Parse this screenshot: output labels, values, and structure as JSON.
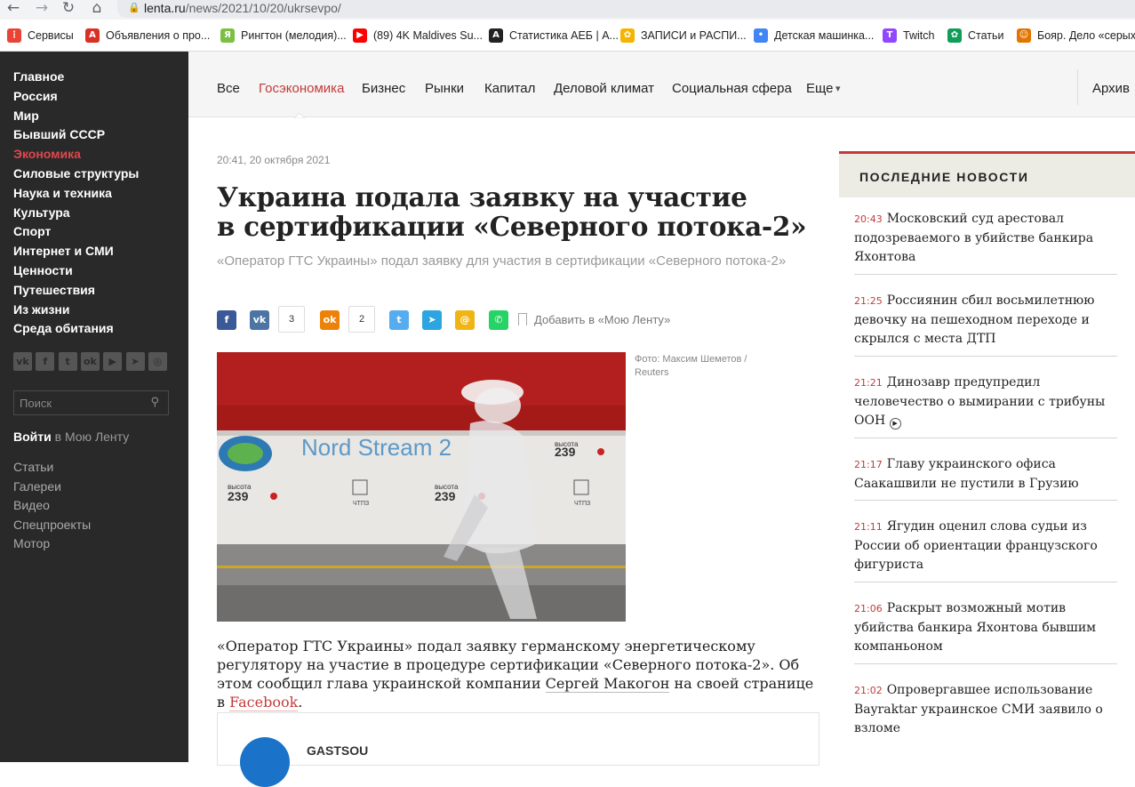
{
  "browser": {
    "url_host": "lenta.ru",
    "url_path": "/news/2021/10/20/ukrsevpo/",
    "bookmarks": [
      {
        "label": "Сервисы",
        "icon": "apps-grid-icon",
        "color": "#e94335"
      },
      {
        "label": "Объявления о про...",
        "icon": "avito-icon",
        "color": "#d93025"
      },
      {
        "label": "Рингтон (мелодия)...",
        "icon": "yandex-icon",
        "color": "#7bc043"
      },
      {
        "label": "(89) 4K Maldives Su...",
        "icon": "youtube-icon",
        "color": "#ff0000"
      },
      {
        "label": "Статистика АЕБ | А...",
        "icon": "aeb-icon",
        "color": "#222222"
      },
      {
        "label": "ЗАПИСИ и РАСПИ...",
        "icon": "colorful-wheel-icon",
        "color": "#f4b400"
      },
      {
        "label": "Детская машинка...",
        "icon": "dots-icon",
        "color": "#4285f4"
      },
      {
        "label": "Twitch",
        "icon": "twitch-icon",
        "color": "#9146ff"
      },
      {
        "label": "Статьи",
        "icon": "colorful-wheel-icon",
        "color": "#0f9d58"
      },
      {
        "label": "Бояр. Дело «серых",
        "icon": "face-icon",
        "color": "#e37400"
      }
    ]
  },
  "sidebar": {
    "links": [
      "Главное",
      "Россия",
      "Мир",
      "Бывший СССР",
      "Экономика",
      "Силовые структуры",
      "Наука и техника",
      "Культура",
      "Спорт",
      "Интернет и СМИ",
      "Ценности",
      "Путешествия",
      "Из жизни",
      "Среда обитания"
    ],
    "active_index": 4,
    "socials": [
      "vk-icon",
      "facebook-icon",
      "twitter-icon",
      "odnoklassniki-icon",
      "youtube-icon",
      "telegram-icon",
      "instagram-icon"
    ],
    "search_placeholder": "Поиск",
    "login_bold": "Войти",
    "login_rest": " в Мою Ленту",
    "sections": [
      "Статьи",
      "Галереи",
      "Видео",
      "Спецпроекты",
      "Мотор"
    ]
  },
  "topnav": {
    "items": [
      "Все",
      "Госэкономика",
      "Бизнес",
      "Рынки",
      "Капитал",
      "Деловой климат",
      "Социальная сфера",
      "Еще"
    ],
    "active_index": 1,
    "archive": "Архив"
  },
  "article": {
    "date": "20:41, 20 октября 2021",
    "title_line1": "Украина подала заявку на участие",
    "title_line2": "в сертификации «Северного потока-2»",
    "subtitle": "«Оператор ГТС Украины» подал заявку для участия в сертификации «Северного потока-2»",
    "share": [
      {
        "icon": "facebook-icon",
        "color": "#3b5998"
      },
      {
        "icon": "vk-icon",
        "color": "#4c75a3",
        "count": "3"
      },
      {
        "icon": "odnoklassniki-icon",
        "color": "#ee8208",
        "count": "2"
      },
      {
        "icon": "twitter-icon",
        "color": "#55acee"
      },
      {
        "icon": "telegram-icon",
        "color": "#2ca5e0"
      },
      {
        "icon": "mail-icon",
        "color": "#f0b515"
      },
      {
        "icon": "whatsapp-icon",
        "color": "#25d366"
      }
    ],
    "add_to_feed": "Добавить в «Мою Ленту»",
    "photo_credit": "Фото: Максим Шеметов / Reuters",
    "photo_text": {
      "brand": "Nord Stream 2",
      "height_label": "высота",
      "height_value": "239",
      "stamp": "ЧТПЗ"
    },
    "body_before": "«Оператор ГТС Украины» подал заявку германскому энергетическому регулятору на участие в процедуре сертификации «Северного потока-2». Об этом сообщил глава украинской компании ",
    "body_link1": "Сергей Макогон",
    "body_mid": " на своей странице в ",
    "body_link2": "Facebook",
    "body_after": ".",
    "embed_name": "GASTSOU"
  },
  "news": {
    "heading": "ПОСЛЕДНИЕ НОВОСТИ",
    "items": [
      {
        "time": "20:43",
        "text": "Московский суд арестовал подозреваемого в убийстве банкира Яхонтова"
      },
      {
        "time": "21:25",
        "text": "Россиянин сбил восьмилетнюю девочку на пешеходном переходе и скрылся с места ДТП"
      },
      {
        "time": "21:21",
        "text": "Динозавр предупредил человечество о вымирании с трибуны ООН"
      },
      {
        "time": "21:17",
        "text": "Главу украинского офиса Саакашвили не пустили в Грузию"
      },
      {
        "time": "21:11",
        "text": "Ягудин оценил слова судьи из России об ориентации французского фигуриста"
      },
      {
        "time": "21:06",
        "text": "Раскрыт возможный мотив убийства банкира Яхонтова бывшим компаньоном"
      },
      {
        "time": "21:02",
        "text": "Опровергавшее использование Bayraktar украинское СМИ заявило о взломе"
      }
    ]
  }
}
